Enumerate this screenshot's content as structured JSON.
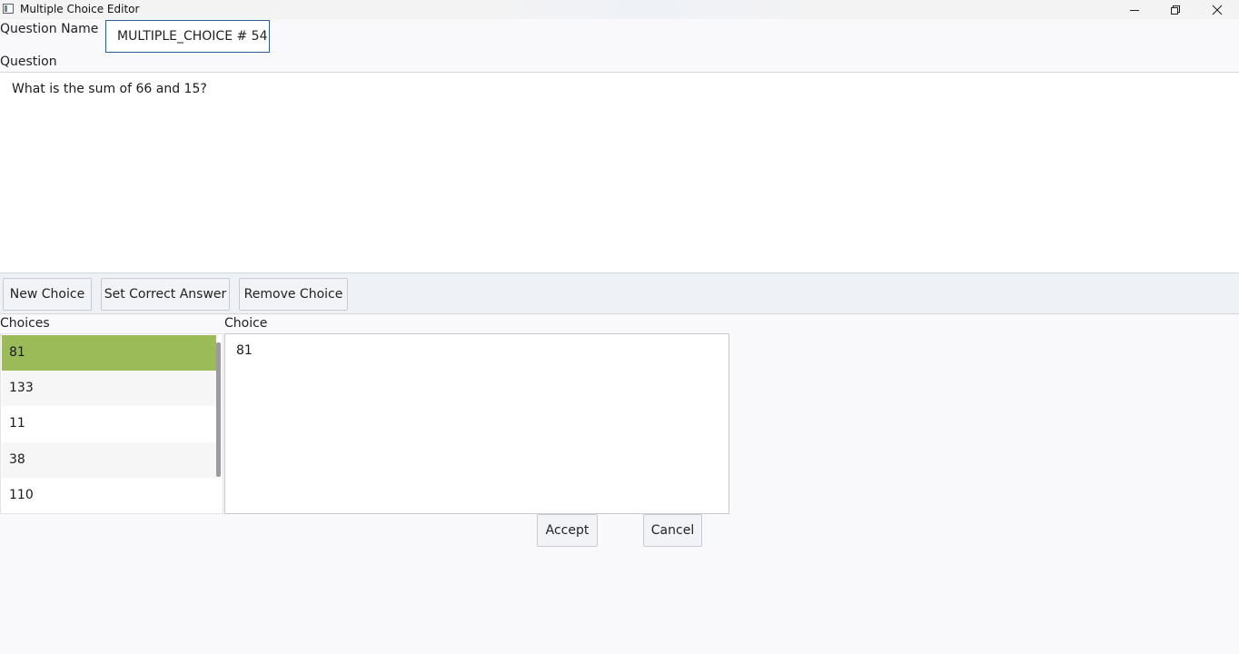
{
  "window": {
    "title": "Multiple Choice Editor",
    "controls": [
      "minimize-icon",
      "restore-icon",
      "close-icon"
    ]
  },
  "form": {
    "question_name_label": "Question Name",
    "question_name_value": "MULTIPLE_CHOICE # 54",
    "question_label": "Question",
    "question_text": "What is the sum of 66 and 15?"
  },
  "toolbar": {
    "new_choice": "New Choice",
    "set_correct_answer": "Set Correct Answer",
    "remove_choice": "Remove Choice"
  },
  "choices": {
    "label": "Choices",
    "items": [
      "81",
      "133",
      "11",
      "38",
      "110"
    ],
    "selected_index": 0,
    "correct_color": "#9bbb59"
  },
  "choice_editor": {
    "label": "Choice",
    "value": "81"
  },
  "actions": {
    "accept": "Accept",
    "cancel": "Cancel"
  }
}
